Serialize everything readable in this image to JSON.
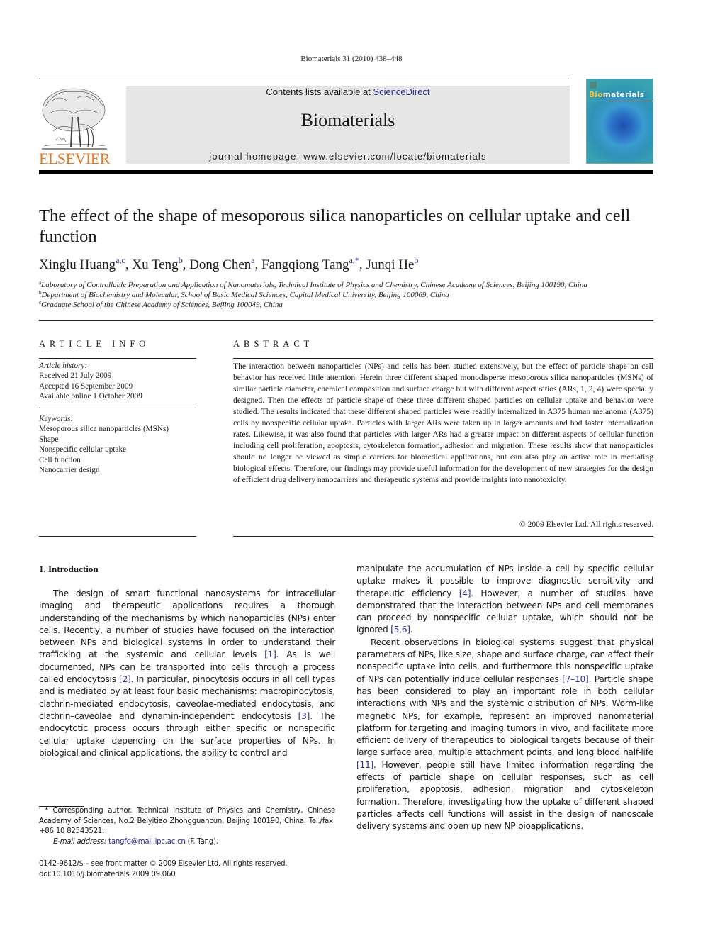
{
  "running_head": "Biomaterials 31 (2010) 438–448",
  "masthead": {
    "publisher_logo_text": "ELSEVIER",
    "contents_prefix": "Contents lists available at ",
    "contents_link": "ScienceDirect",
    "journal_name": "Biomaterials",
    "homepage": "journal homepage: www.elsevier.com/locate/biomaterials",
    "cover_title_bio": "Bio",
    "cover_title_rest": "materials",
    "colors": {
      "elsevier_orange": "#e87722",
      "link_blue": "#2a2e8c",
      "masthead_gray": "#e6e6e6"
    }
  },
  "article": {
    "title": "The effect of the shape of mesoporous silica nanoparticles on cellular uptake and cell function",
    "authors": [
      {
        "name": "Xinglu Huang",
        "affil": "a,c"
      },
      {
        "name": "Xu Teng",
        "affil": "b"
      },
      {
        "name": "Dong Chen",
        "affil": "a"
      },
      {
        "name": "Fangqiong Tang",
        "affil": "a,*"
      },
      {
        "name": "Junqi He",
        "affil": "b"
      }
    ],
    "affiliations": [
      {
        "mark": "a",
        "text": "Laboratory of Controllable Preparation and Application of Nanomaterials, Technical Institute of Physics and Chemistry, Chinese Academy of Sciences, Beijing 100190, China"
      },
      {
        "mark": "b",
        "text": "Department of Biochemistry and Molecular, School of Basic Medical Sciences, Capital Medical University, Beijing 100069, China"
      },
      {
        "mark": "c",
        "text": "Graduate School of the Chinese Academy of Sciences, Beijing 100049, China"
      }
    ]
  },
  "article_info": {
    "heading": "ARTICLE INFO",
    "history_label": "Article history:",
    "history": [
      "Received 21 July 2009",
      "Accepted 16 September 2009",
      "Available online 1 October 2009"
    ],
    "keywords_label": "Keywords:",
    "keywords": [
      "Mesoporous silica nanoparticles (MSNs)",
      "Shape",
      "Nonspecific cellular uptake",
      "Cell function",
      "Nanocarrier design"
    ]
  },
  "abstract": {
    "heading": "ABSTRACT",
    "text": "The interaction between nanoparticles (NPs) and cells has been studied extensively, but the effect of particle shape on cell behavior has received little attention. Herein three different shaped monodisperse mesoporous silica nanoparticles (MSNs) of similar particle diameter, chemical composition and surface charge but with different aspect ratios (ARs, 1, 2, 4) were specially designed. Then the effects of particle shape of these three different shaped particles on cellular uptake and behavior were studied. The results indicated that these different shaped particles were readily internalized in A375 human melanoma (A375) cells by nonspecific cellular uptake. Particles with larger ARs were taken up in larger amounts and had faster internalization rates. Likewise, it was also found that particles with larger ARs had a greater impact on different aspects of cellular function including cell proliferation, apoptosis, cytoskeleton formation, adhesion and migration. These results show that nanoparticles should no longer be viewed as simple carriers for biomedical applications, but can also play an active role in mediating biological effects. Therefore, our findings may provide useful information for the development of new strategies for the design of efficient drug delivery nanocarriers and therapeutic systems and provide insights into nanotoxicity.",
    "copyright": "© 2009 Elsevier Ltd. All rights reserved."
  },
  "introduction": {
    "heading": "1.  Introduction",
    "left_p1_parts": [
      "The design of smart functional nanosystems for intracellular imaging and therapeutic applications requires a thorough understanding of the mechanisms by which nanoparticles (NPs) enter cells. Recently, a number of studies have focused on the interaction between NPs and biological systems in order to understand their trafficking at the systemic and cellular levels ",
      "[1]",
      ". As is well documented, NPs can be transported into cells through a process called endocytosis ",
      "[2]",
      ". In particular, pinocytosis occurs in all cell types and is mediated by at least four basic mechanisms: macropinocytosis, clathrin-mediated endocytosis, caveolae-mediated endocytosis, and clathrin–caveolae and dynamin-independent endocytosis ",
      "[3]",
      ". The endocytotic process occurs through either specific or nonspecific cellular uptake depending on the surface properties of NPs. In biological and clinical applications, the ability to control and"
    ],
    "right_p1_parts": [
      "manipulate the accumulation of NPs inside a cell by specific cellular uptake makes it possible to improve diagnostic sensitivity and therapeutic efficiency ",
      "[4]",
      ". However, a number of studies have demonstrated that the interaction between NPs and cell membranes can proceed by nonspecific cellular uptake, which should not be ignored ",
      "[5,6]",
      "."
    ],
    "right_p2_parts": [
      "Recent observations in biological systems suggest that physical parameters of NPs, like size, shape and surface charge, can affect their nonspecific uptake into cells, and furthermore this nonspecific uptake of NPs can potentially induce cellular responses ",
      "[7–10]",
      ". Particle shape has been considered to play an important role in both cellular interactions with NPs and the systemic distribution of NPs. Worm-like magnetic NPs, for example, represent an improved nanomaterial platform for targeting and imaging tumors in vivo, and facilitate more efficient delivery of therapeutics to biological targets because of their large surface area, multiple attachment points, and long blood half-life ",
      "[11]",
      ". However, people still have limited information regarding the effects of particle shape on cellular responses, such as cell proliferation, apoptosis, adhesion, migration and cytoskeleton formation. Therefore, investigating how the uptake of different shaped particles affects cell functions will assist in the design of nanoscale delivery systems and open up new NP bioapplications."
    ]
  },
  "footnote": {
    "corresponding": "* Corresponding author. Technical Institute of Physics and Chemistry, Chinese Academy of Sciences, No.2 Beiyitiao Zhongguancun, Beijing 100190, China. Tel./fax: +86 10 82543521.",
    "email_label": "E-mail address:",
    "email": "tangfq@mail.ipc.ac.cn",
    "email_suffix": " (F. Tang)."
  },
  "footer": {
    "issn_line": "0142-9612/$ – see front matter © 2009 Elsevier Ltd. All rights reserved.",
    "doi": "doi:10.1016/j.biomaterials.2009.09.060"
  }
}
